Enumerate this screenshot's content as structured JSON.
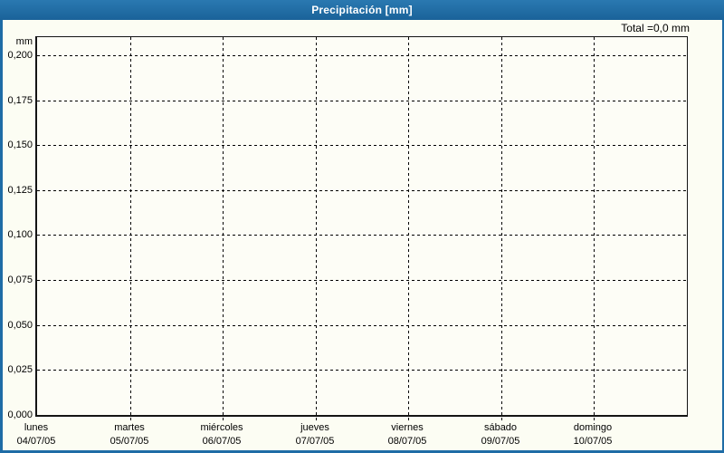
{
  "header": {
    "title": "Precipitación [mm]"
  },
  "summary": {
    "total_label": "Total =0,0 mm"
  },
  "colors": {
    "titlebar_blue": "#1e6ca6",
    "frame_border_blue": "#1e6ca6",
    "panel_background": "#fcfdf3",
    "grid_line": "#000000",
    "axis_text": "#000000",
    "title_text": "#ffffff"
  },
  "y_axis": {
    "unit": "mm",
    "max_value": 0.21,
    "ticks": [
      {
        "label": "0,200",
        "value": 0.2
      },
      {
        "label": "0,175",
        "value": 0.175
      },
      {
        "label": "0,150",
        "value": 0.15
      },
      {
        "label": "0,125",
        "value": 0.125
      },
      {
        "label": "0,100",
        "value": 0.1
      },
      {
        "label": "0,075",
        "value": 0.075
      },
      {
        "label": "0,050",
        "value": 0.05
      },
      {
        "label": "0,025",
        "value": 0.025
      },
      {
        "label": "0,000",
        "value": 0.0
      }
    ]
  },
  "x_axis": {
    "days": [
      {
        "name": "lunes",
        "date": "04/07/05"
      },
      {
        "name": "martes",
        "date": "05/07/05"
      },
      {
        "name": "miércoles",
        "date": "06/07/05"
      },
      {
        "name": "jueves",
        "date": "07/07/05"
      },
      {
        "name": "viernes",
        "date": "08/07/05"
      },
      {
        "name": "sábado",
        "date": "09/07/05"
      },
      {
        "name": "domingo",
        "date": "10/07/05"
      }
    ]
  },
  "chart_data": {
    "type": "bar",
    "title": "Precipitación [mm]",
    "xlabel": "",
    "ylabel": "mm",
    "ylim": [
      0,
      0.21
    ],
    "y_tick_step": 0.025,
    "categories": [
      "lunes 04/07/05",
      "martes 05/07/05",
      "miércoles 06/07/05",
      "jueves 07/07/05",
      "viernes 08/07/05",
      "sábado 09/07/05",
      "domingo 10/07/05"
    ],
    "series": [
      {
        "name": "Precipitación",
        "values": [
          0,
          0,
          0,
          0,
          0,
          0,
          0
        ]
      }
    ],
    "total": "0,0 mm",
    "grid": true,
    "legend_position": "none"
  }
}
